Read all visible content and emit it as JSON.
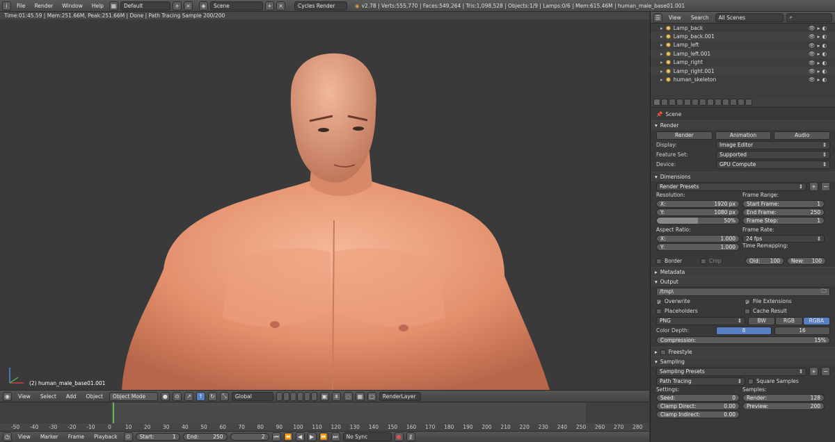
{
  "topbar": {
    "menus": [
      "File",
      "Render",
      "Window",
      "Help"
    ],
    "layout": "Default",
    "scene": "Scene",
    "engine": "Cycles Render",
    "stats": "v2.78 | Verts:555,770 | Faces:549,264 | Tris:1,098,528 | Objects:1/9 | Lamps:0/6 | Mem:615.46M | human_male_base01.001"
  },
  "viewport": {
    "status": "Time:01:45.59 | Mem:251.66M, Peak:251.66M | Done | Path Tracing Sample 200/200",
    "object_label": "(2) human_male_base01.001"
  },
  "view_header": {
    "menus": [
      "View",
      "Select",
      "Add",
      "Object"
    ],
    "mode": "Object Mode",
    "orientation": "Global",
    "layer": "RenderLayer"
  },
  "timeline": {
    "ticks": [
      "-50",
      "-40",
      "-30",
      "-20",
      "-10",
      "0",
      "10",
      "20",
      "30",
      "40",
      "50",
      "60",
      "70",
      "80",
      "90",
      "100",
      "110",
      "120",
      "130",
      "140",
      "150",
      "160",
      "170",
      "180",
      "190",
      "200",
      "210",
      "220",
      "230",
      "240",
      "250",
      "260",
      "270",
      "280"
    ],
    "menus": [
      "View",
      "Marker",
      "Frame",
      "Playback"
    ],
    "start_label": "Start:",
    "start": "1",
    "end_label": "End:",
    "end": "250",
    "current": "2",
    "sync": "No Sync"
  },
  "outliner": {
    "menus": [
      "View",
      "Search"
    ],
    "filter": "All Scenes",
    "items": [
      "Lamp_back",
      "Lamp_back.001",
      "Lamp_left",
      "Lamp_left.001",
      "Lamp_right",
      "Lamp_right.001",
      "human_skeleton"
    ]
  },
  "props": {
    "scene_label": "Scene",
    "render": {
      "title": "Render",
      "render_btn": "Render",
      "anim_btn": "Animation",
      "audio_btn": "Audio",
      "display_label": "Display:",
      "display": "Image Editor",
      "feature_label": "Feature Set:",
      "feature": "Supported",
      "device_label": "Device:",
      "device": "GPU Compute"
    },
    "dimensions": {
      "title": "Dimensions",
      "presets": "Render Presets",
      "res_label": "Resolution:",
      "x_label": "X:",
      "x": "1920 px",
      "y_label": "Y:",
      "y": "1080 px",
      "pct": "50%",
      "frange_label": "Frame Range:",
      "start_label": "Start Frame:",
      "start": "1",
      "end_label": "End Frame:",
      "end": "250",
      "step_label": "Frame Step:",
      "step": "1",
      "aspect_label": "Aspect Ratio:",
      "ax": "1.000",
      "ay": "1.000",
      "fps_label": "Frame Rate:",
      "fps": "24 fps",
      "remap_label": "Time Remapping:",
      "old_label": "Old:",
      "old": "100",
      "new_label": "New:",
      "new": "100",
      "border": "Border",
      "crop": "Crop"
    },
    "metadata": {
      "title": "Metadata"
    },
    "output": {
      "title": "Output",
      "path": "/tmp\\",
      "overwrite": "Overwrite",
      "file_ext": "File Extensions",
      "placeholders": "Placeholders",
      "cache": "Cache Result",
      "format": "PNG",
      "bw": "BW",
      "rgb": "RGB",
      "rgba": "RGBA",
      "depth_label": "Color Depth:",
      "d8": "8",
      "d16": "16",
      "comp_label": "Compression:",
      "comp": "15%"
    },
    "freestyle": {
      "title": "Freestyle"
    },
    "sampling": {
      "title": "Sampling",
      "presets": "Sampling Presets",
      "integrator": "Path Tracing",
      "square": "Square Samples",
      "settings_label": "Settings:",
      "seed_label": "Seed:",
      "seed": "0",
      "clampd_label": "Clamp Direct:",
      "clampd": "0.00",
      "clampi_label": "Clamp Indirect:",
      "clampi": "0.00",
      "samples_label": "Samples:",
      "rs_label": "Render:",
      "rs": "128",
      "ps_label": "Preview:",
      "ps": "200"
    }
  },
  "colors": {
    "accent": "#5680c2",
    "skin": "#e59a78",
    "bg": "#393939"
  }
}
